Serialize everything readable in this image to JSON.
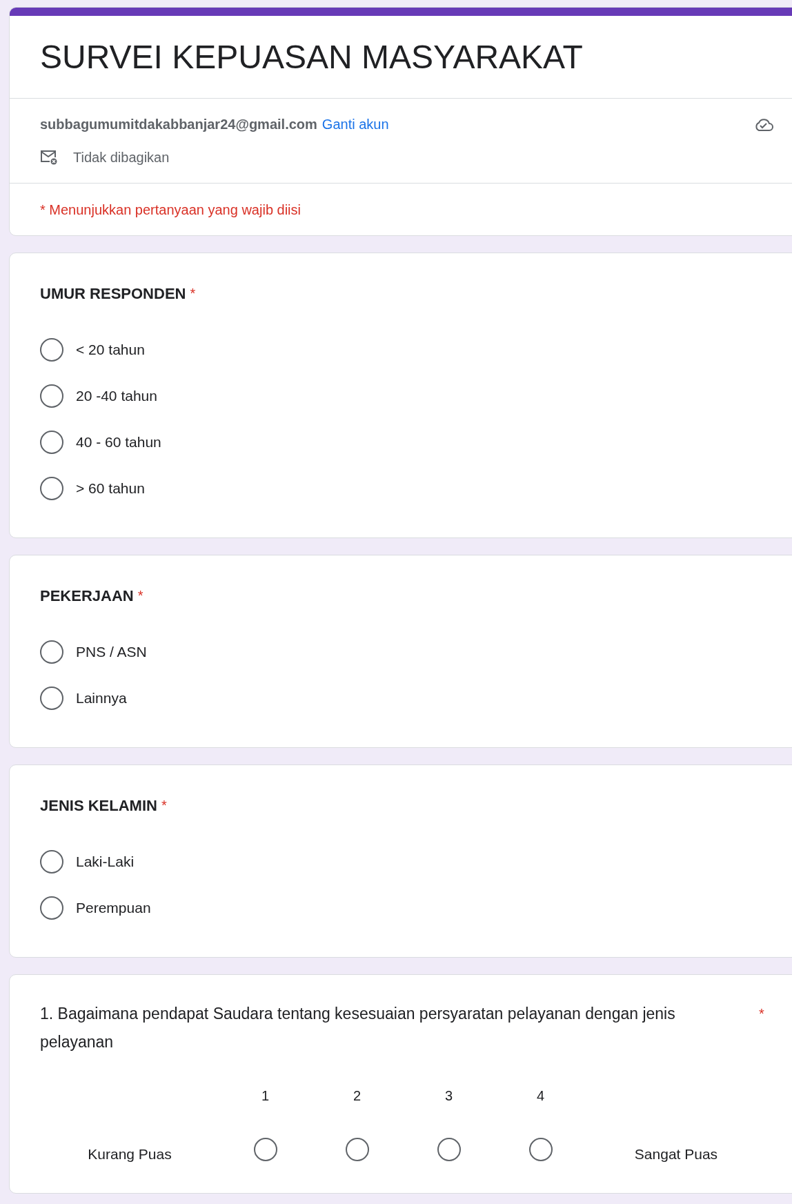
{
  "form": {
    "title": "SURVEI KEPUASAN MASYARAKAT",
    "email": "subbagumumitdakabbanjar24@gmail.com",
    "switch_link": "Ganti akun",
    "sharing": "Tidak dibagikan",
    "required_note": "* Menunjukkan pertanyaan yang wajib diisi"
  },
  "questions": [
    {
      "kind": "choice",
      "title": "UMUR RESPONDEN",
      "required_mark": "*",
      "options": [
        {
          "label": "< 20 tahun",
          "selected": false
        },
        {
          "label": "20 -40 tahun",
          "selected": false
        },
        {
          "label": "40 - 60 tahun",
          "selected": false
        },
        {
          "label": "> 60 tahun",
          "selected": false
        }
      ]
    },
    {
      "kind": "choice",
      "title": "PEKERJAAN",
      "required_mark": "*",
      "options": [
        {
          "label": "PNS / ASN",
          "selected": false
        },
        {
          "label": "Lainnya",
          "selected": false
        }
      ]
    },
    {
      "kind": "choice",
      "title": "JENIS KELAMIN",
      "required_mark": "*",
      "options": [
        {
          "label": "Laki-Laki",
          "selected": false
        },
        {
          "label": "Perempuan",
          "selected": false
        }
      ]
    },
    {
      "kind": "scale",
      "title": "1. Bagaimana pendapat Saudara tentang kesesuaian persyaratan pelayanan dengan jenis pelayanan",
      "required_mark": "*",
      "low_label": "Kurang Puas",
      "high_label": "Sangat Puas",
      "options": [
        {
          "label": "1",
          "selected": false
        },
        {
          "label": "2",
          "selected": false
        },
        {
          "label": "3",
          "selected": false
        },
        {
          "label": "4",
          "selected": false
        }
      ]
    }
  ]
}
